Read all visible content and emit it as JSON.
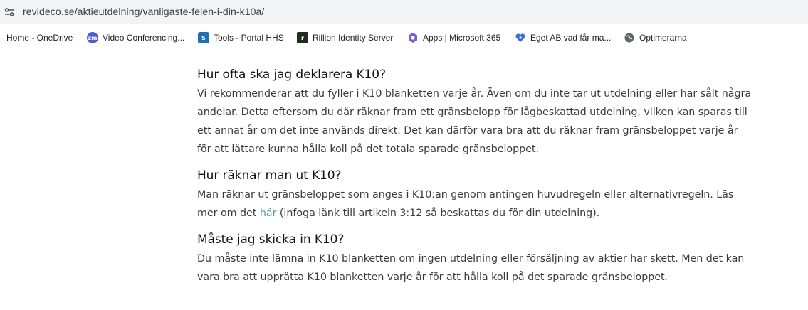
{
  "browser": {
    "url": "revideco.se/aktieutdelning/vanligaste-felen-i-din-k10a/"
  },
  "bookmarks": [
    {
      "label": "Home - OneDrive",
      "icon": "onedrive-icon",
      "color": "#0078d4",
      "glyph": ""
    },
    {
      "label": "Video Conferencing...",
      "icon": "zoom-icon",
      "color": "#4a5bd4",
      "glyph": "zm"
    },
    {
      "label": "Tools - Portal HHS",
      "icon": "sharepoint-icon",
      "color": "#1b6fb3",
      "glyph": "S"
    },
    {
      "label": "Rillion Identity Server",
      "icon": "rillion-icon",
      "color": "#1f2d1f",
      "glyph": "r"
    },
    {
      "label": "Apps | Microsoft 365",
      "icon": "microsoft365-icon",
      "color": "#7b5cd6",
      "glyph": ""
    },
    {
      "label": "Eget AB vad får ma...",
      "icon": "heart-icon",
      "color": "#3b6fd8",
      "glyph": ""
    },
    {
      "label": "Optimerarna",
      "icon": "globe-icon",
      "color": "#5f6368",
      "glyph": ""
    }
  ],
  "article": {
    "sections": [
      {
        "heading": "Hur ofta ska jag deklarera K10?",
        "lines": [
          "Vi rekommenderar att du fyller i K10 blanketten varje år. Även om du inte tar ut utdelning eller har sålt några",
          "andelar. Detta eftersom du där räknar fram ett gränsbelopp för lågbeskattad utdelning, vilken kan sparas till",
          "ett annat år om det inte används direkt. Det kan därför vara bra att du räknar fram gränsbeloppet varje år",
          "för att lättare kunna hålla koll på det totala sparade gränsbeloppet."
        ]
      },
      {
        "heading": "Hur räknar man ut K10?",
        "line1": "Man räknar ut gränsbeloppet som anges i K10:an genom antingen huvudregeln eller alternativregeln. Läs",
        "line2_before": "mer om det ",
        "link": "här",
        "line2_after": " (infoga länk till artikeln 3:12 så beskattas du för din utdelning)."
      },
      {
        "heading": "Måste jag skicka in K10?",
        "lines": [
          "Du måste inte lämna in K10 blanketten om ingen utdelning eller försäljning av aktier har skett. Men det kan",
          "vara bra att upprätta K10 blanketten varje år för att hålla koll på det sparade gränsbeloppet."
        ]
      }
    ]
  }
}
